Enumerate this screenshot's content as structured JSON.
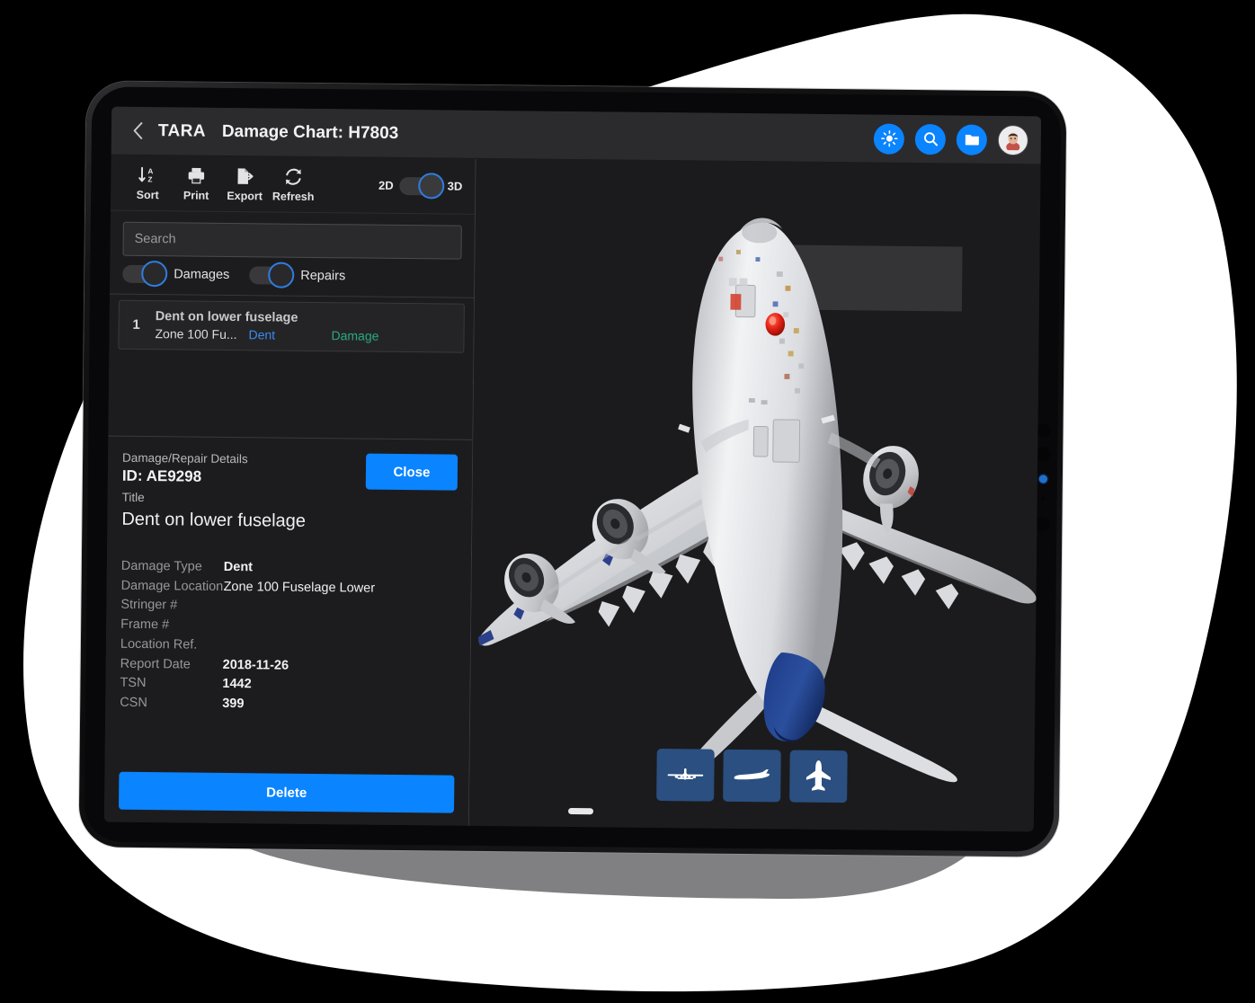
{
  "header": {
    "back_icon": "chevron-left-icon",
    "brand": "TARA",
    "title": "Damage Chart: H7803",
    "actions": [
      {
        "name": "brightness-button",
        "icon": "brightness-icon"
      },
      {
        "name": "search-button",
        "icon": "search-icon"
      },
      {
        "name": "folder-button",
        "icon": "folder-icon"
      }
    ],
    "avatar_name": "user-avatar"
  },
  "toolbar": {
    "tools": [
      {
        "label": "Sort",
        "icon": "sort-az-icon"
      },
      {
        "label": "Print",
        "icon": "printer-icon"
      },
      {
        "label": "Export",
        "icon": "export-document-icon"
      },
      {
        "label": "Refresh",
        "icon": "refresh-icon"
      }
    ],
    "dim_toggle": {
      "left_label": "2D",
      "right_label": "3D",
      "state": "3D"
    }
  },
  "search": {
    "value": "",
    "placeholder": "Search"
  },
  "filters": [
    {
      "label": "Damages",
      "on": true
    },
    {
      "label": "Repairs",
      "on": true
    }
  ],
  "list": {
    "rows": [
      {
        "index": "1",
        "title": "Dent on lower fuselage",
        "zone": "Zone 100 Fu...",
        "type": "Dent",
        "category": "Damage"
      }
    ]
  },
  "details": {
    "caption": "Damage/Repair Details",
    "id": "ID: AE9298",
    "title_label": "Title",
    "title": "Dent on lower fuselage",
    "close_label": "Close",
    "delete_label": "Delete",
    "fields": [
      {
        "key": "Damage Type",
        "value": "Dent"
      },
      {
        "key": "Damage Location",
        "value": "Zone 100 Fuselage Lower"
      },
      {
        "key": "Stringer #",
        "value": ""
      },
      {
        "key": "Frame #",
        "value": ""
      },
      {
        "key": "Location Ref.",
        "value": ""
      },
      {
        "key": "Report Date",
        "value": "2018-11-26"
      },
      {
        "key": "TSN",
        "value": "1442"
      },
      {
        "key": "CSN",
        "value": "399"
      }
    ]
  },
  "viewport": {
    "model": "airbus-a380-3d-model",
    "view_buttons": [
      {
        "name": "front-view-button",
        "icon": "aircraft-front-icon"
      },
      {
        "name": "side-view-button",
        "icon": "aircraft-side-icon"
      },
      {
        "name": "top-view-button",
        "icon": "aircraft-top-icon"
      }
    ]
  },
  "colors": {
    "accent_blue": "#0a84ff",
    "toggle_ring": "#2f7de0",
    "type_blue": "#3b8aee",
    "category_green": "#2aa882",
    "view_btn_blue": "#2a4f80",
    "panel_bg": "#1c1c1e",
    "header_bg": "#2b2b2d"
  }
}
